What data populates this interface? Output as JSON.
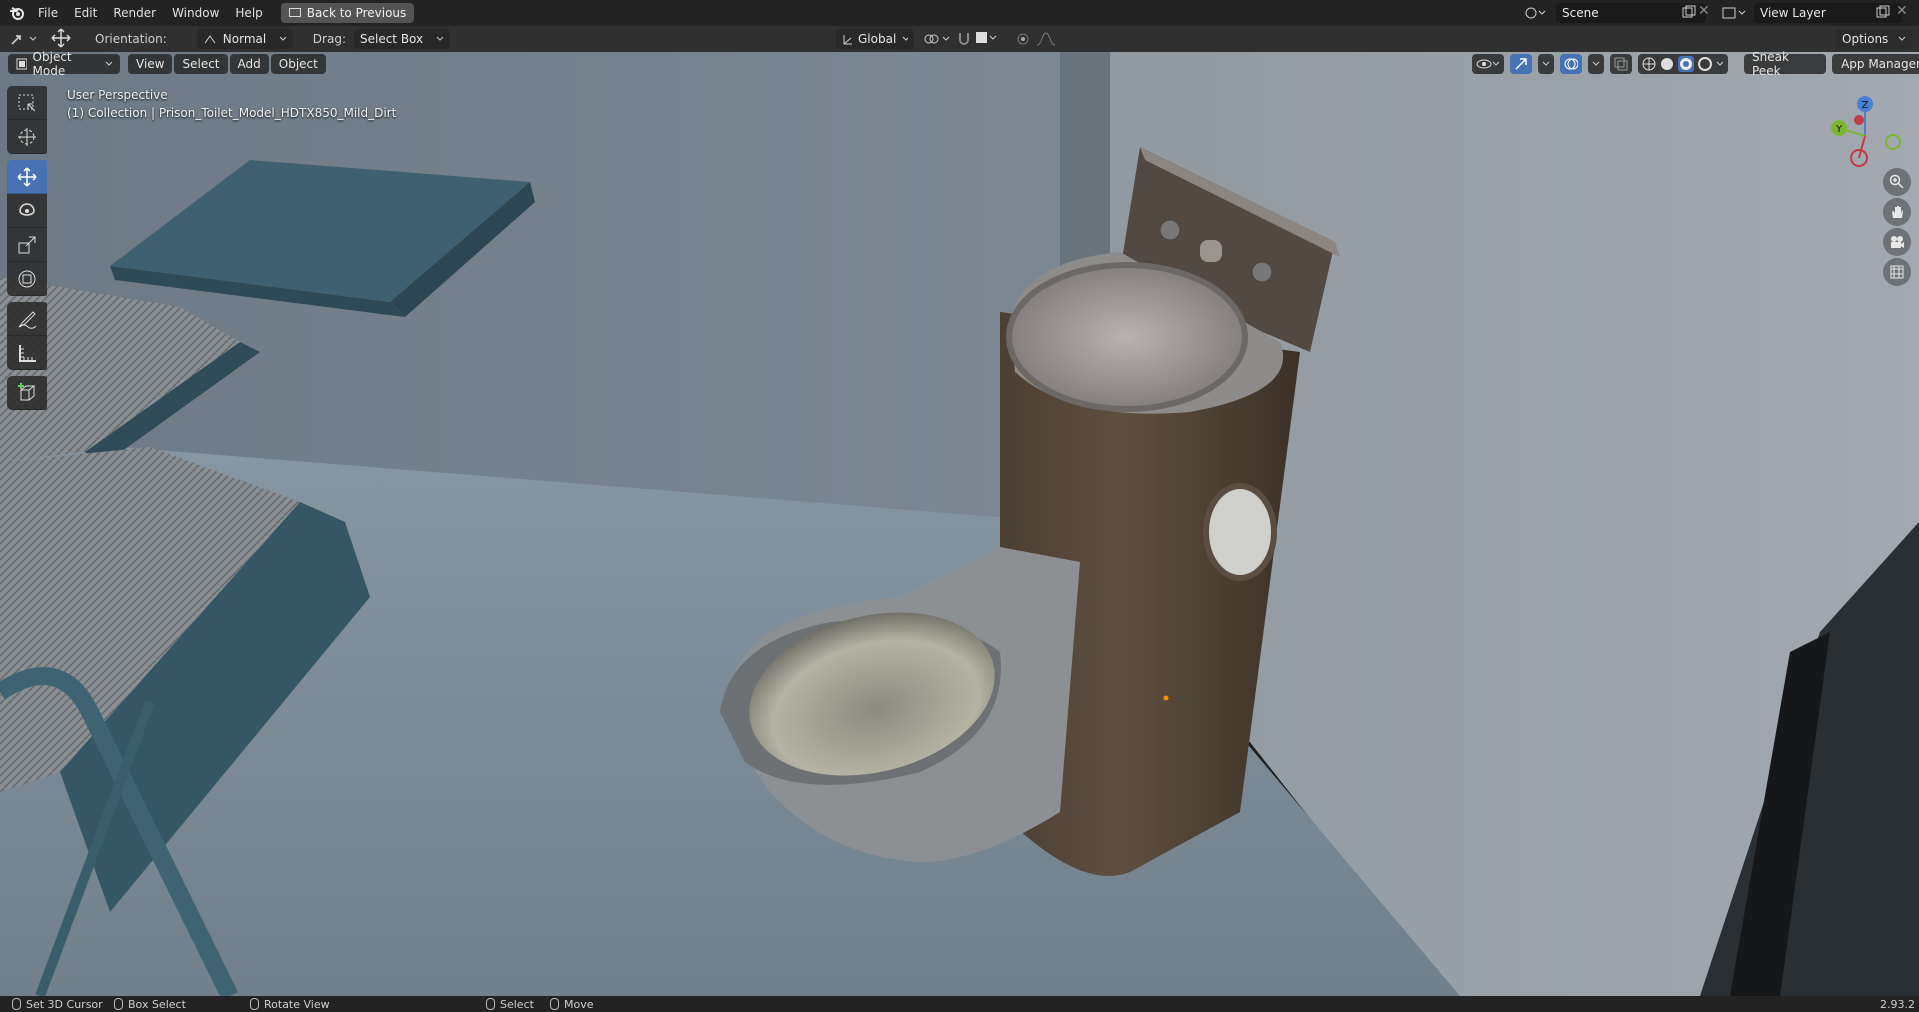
{
  "menu": {
    "items": [
      "File",
      "Edit",
      "Render",
      "Window",
      "Help"
    ],
    "back_button": "Back to Previous"
  },
  "scene": {
    "label": "Scene"
  },
  "view_layer": {
    "label": "View Layer"
  },
  "tool_header": {
    "orientation_label": "Orientation:",
    "orientation_value": "Normal",
    "drag_label": "Drag:",
    "drag_value": "Select Box",
    "transform_orientation": "Global",
    "options_label": "Options"
  },
  "viewport_header": {
    "mode": "Object Mode",
    "menus": [
      "View",
      "Select",
      "Add",
      "Object"
    ],
    "sneak_peek": "Sneak Peek",
    "app_manager": "App Manager"
  },
  "viewport_info": {
    "perspective": "User Perspective",
    "collection": "(1) Collection | Prison_Toilet_Model_HDTX850_Mild_Dirt"
  },
  "gizmo": {
    "z": "Z",
    "y": "Y"
  },
  "status": {
    "set_cursor": "Set 3D Cursor",
    "box_select": "Box Select",
    "rotate_view": "Rotate View",
    "select": "Select",
    "move": "Move",
    "version": "2.93.2"
  }
}
